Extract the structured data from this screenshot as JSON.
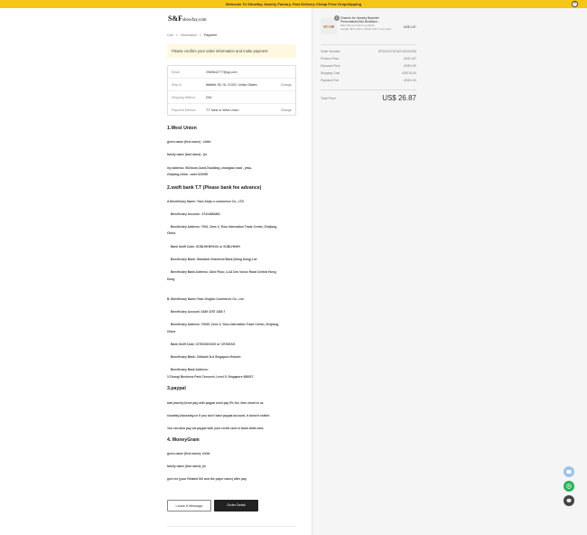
{
  "topbar": {
    "message": "Welcome To Showfay Jewelry Factory. Fast Delivery Cheap Price Dropshipping",
    "close": "×"
  },
  "logo": {
    "brand": "S&F",
    "domain": "showfay.com"
  },
  "breadcrumb": {
    "cart": "Cart",
    "sep1": ">",
    "information": "Information",
    "sep2": ">",
    "payment": "Payment"
  },
  "notice": "Please confirm your order information and make payment",
  "info": {
    "email_label": "Email",
    "email_value": "2969642777@qq.com",
    "ship_label": "Ship to",
    "ship_value": "ttttttttttt, 55, HL 21000, United States",
    "ship_change": "Change",
    "method_label": "Shipping Method",
    "method_value": "DHL",
    "pay_label": "Payment Method",
    "pay_value": "T.T bank or West Union",
    "pay_change": "Change"
  },
  "content": {
    "h1": "1.West Union",
    "wu1": "given name (first name) : zhifei",
    "wu2": "family name (last name) : jin",
    "wu3": "my address: 502room,3unit,7building ,changtao road , yiwu,",
    "wu4": "zhejiang,china . code:322000",
    "h2": "2.swift bank T.T (Please bank fee advance)",
    "a0": "A.Beneficiary Name: Yiwu Xinjiu e-commerce Co., LTD",
    "a1": "Beneficiary Account : 47414661861",
    "a2": "Beneficiary Address: 7004, Zone 3, Yiwu Internation Trade Center, Zhejiang,",
    "a3": "China",
    "a4": "Bank Swift Code: SCBLHKHHXXX or SCBLHKHH",
    "a5": "Beneficiary Bank: Standard Chartered Bank (Hong Kong) Ltd",
    "a6": "Beneficiary Bank Address: 32nd Floor, 4-4A Des Voeux Road Central Hong",
    "a7": "Kong",
    "b0": "B. Beneficiary Name:Yiwu Xingxiu Commerce Co., Ltd.",
    "b1": "Beneficiary Account :1839 4787 1383 7",
    "b2": "Beneficiary Address: 70049, Zone 3, Yiwu Internation Trade Center, Zhejiang,",
    "b3": "China",
    "b4": "Bank Swift Code: CITISGSGXXX or CITISGSG",
    "b5": "Beneficiary Bank: Citibank N.A Singapore Branch",
    "b6": "Beneficiary Bank Address:",
    "b7": "3 Changi Business Park Crescent, Level 5, Singapore 486027",
    "h3": "3.paypal",
    "p1": "add jewelry@root pay with paypal need pay 5% fee, then email to us",
    "p2": "showfay@showfay.cn If you don't have paypal account, it doesn't matter.",
    "p3": "You can also pay via paypal with your credit card or bank debit card.",
    "h4": "4.  MoneyGram",
    "m1": "given name (first name): zhifei",
    "m2": "family name (last name): jin",
    "m3": "give me (your Related NO and the payer name) after pay."
  },
  "buttons": {
    "leave_message": "Leave A Message",
    "order_detail": "Order Detail"
  },
  "product": {
    "qty": "1",
    "name": "Charms for Jewelry Bracelet Personalized Bar Necklace...",
    "variant": "Main Stone Color:1 pendant, Length:45cm+5cm, Metal Color: rose gold",
    "price": "US$ 1.87"
  },
  "summary": {
    "order_number_label": "Order Number",
    "order_number": "SF20220716762134031096",
    "product_price_label": "Product Price",
    "product_price": "US$ 1.87",
    "discount_label": "Discount Price",
    "discount": "US$ 0.00",
    "shipping_label": "Shipping Cost",
    "shipping": "US$ 25.00",
    "payment_fee_label": "Payment Fee",
    "payment_fee": "US$ 0.00",
    "total_label": "Total Price",
    "total": "US$ 26.87"
  },
  "colors": {
    "topbar": "#f5c518",
    "notice_bg": "#fff8e1",
    "primary_button": "#222222",
    "whatsapp": "#25b35c"
  },
  "icons": {
    "float1": "contact-icon",
    "float2": "whatsapp-icon",
    "float3": "chat-icon"
  }
}
